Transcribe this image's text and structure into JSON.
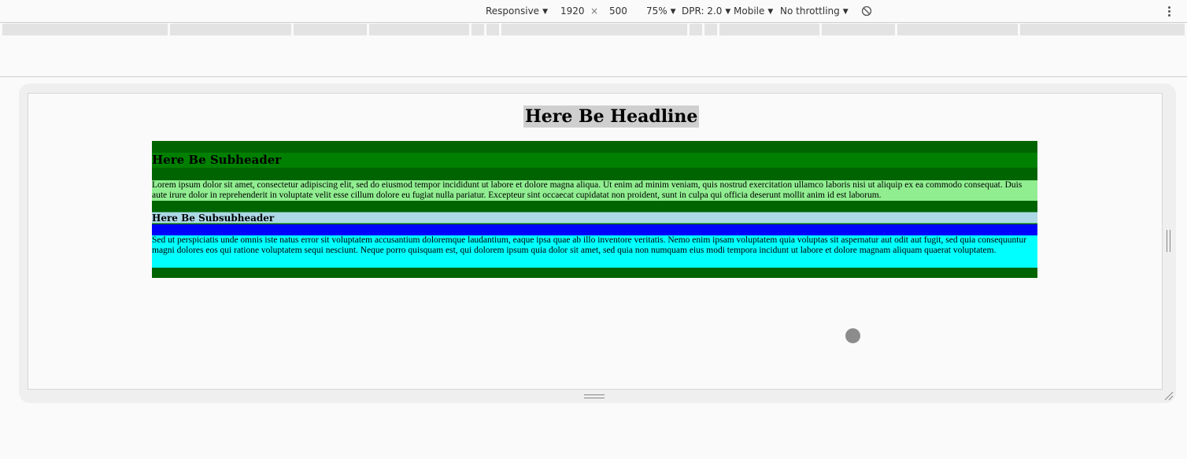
{
  "toolbar": {
    "device": "Responsive",
    "width": "1920",
    "times": "×",
    "height": "500",
    "zoom": "75%",
    "dpr": "DPR: 2.0",
    "mode": "Mobile",
    "throttling": "No throttling",
    "rotate_icon": "rotate-icon",
    "more_icon": "kebab-menu-icon"
  },
  "page": {
    "headline": "Here Be Headline",
    "subheader": "Here Be Subheader",
    "paragraph1": "Lorem ipsum dolor sit amet, consectetur adipiscing elit, sed do eiusmod tempor incididunt ut labore et dolore magna aliqua. Ut enim ad minim veniam, quis nostrud exercitation ullamco laboris nisi ut aliquip ex ea commodo consequat. Duis aute irure dolor in reprehenderit in voluptate velit esse cillum dolore eu fugiat nulla pariatur. Excepteur sint occaecat cupidatat non proident, sunt in culpa qui officia deserunt mollit anim id est laborum.",
    "subsubheader": "Here Be Subsubheader",
    "paragraph2": "Sed ut perspiciatis unde omnis iste natus error sit voluptatem accusantium doloremque laudantium, eaque ipsa quae ab illo inventore veritatis. Nemo enim ipsam voluptatem quia voluptas sit aspernatur aut odit aut fugit, sed quia consequuntur magni dolores eos qui ratione voluptatem sequi nesciunt. Neque porro quisquam est, qui dolorem ipsum quia dolor sit amet, sed quia non numquam eius modi tempora incidunt ut labore et dolore magnam aliquam quaerat voluptatem."
  },
  "colors": {
    "article_bg": "#006400",
    "subheader_bg": "#008000",
    "paragraph1_bg": "#90ee90",
    "subsubheader_bg": "#add8e6",
    "blue_band": "#0000ff",
    "paragraph2_bg": "#00ffff",
    "headline_bg": "#cfcfcf"
  }
}
